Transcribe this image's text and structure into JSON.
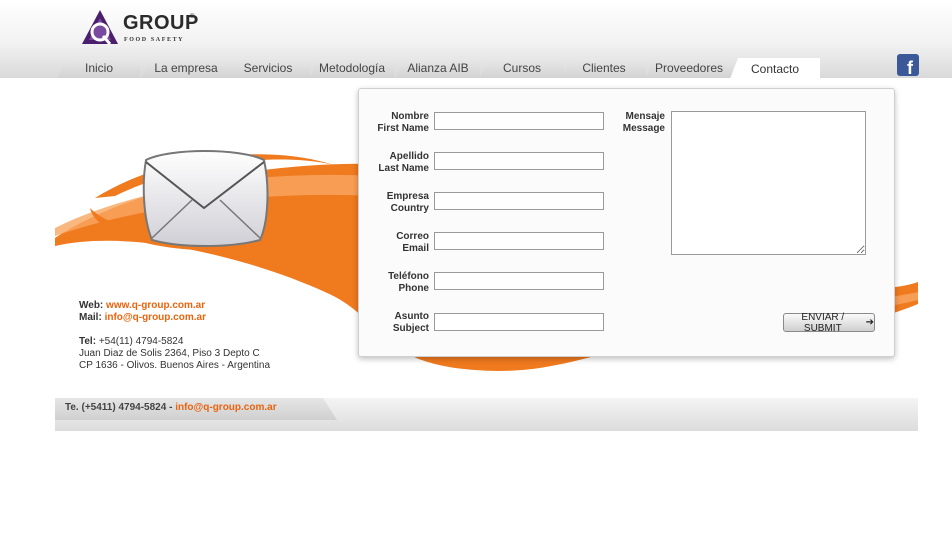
{
  "logo": {
    "word": "GROUP",
    "registered": "®",
    "tagline": "FOOD SAFETY"
  },
  "nav": {
    "tabs": [
      {
        "label": "Inicio"
      },
      {
        "label": "La empresa"
      },
      {
        "label": "Servicios"
      },
      {
        "label": "Metodología"
      },
      {
        "label": "Alianza AIB"
      },
      {
        "label": "Cursos"
      },
      {
        "label": "Clientes"
      },
      {
        "label": "Proveedores"
      },
      {
        "label": "Contacto"
      }
    ],
    "active": "Contacto"
  },
  "social": {
    "facebook_glyph": "f"
  },
  "form": {
    "fields": [
      {
        "label_es": "Nombre",
        "label_en": "First Name",
        "value": ""
      },
      {
        "label_es": "Apellido",
        "label_en": "Last Name",
        "value": ""
      },
      {
        "label_es": "Empresa",
        "label_en": "Country",
        "value": ""
      },
      {
        "label_es": "Correo",
        "label_en": "Email",
        "value": ""
      },
      {
        "label_es": "Teléfono",
        "label_en": "Phone",
        "value": ""
      },
      {
        "label_es": "Asunto",
        "label_en": "Subject",
        "value": ""
      }
    ],
    "message": {
      "label_es": "Mensaje",
      "label_en": "Message",
      "value": ""
    },
    "submit_label": "ENVIAR / SUBMIT",
    "submit_arrow": "➔"
  },
  "contact": {
    "web_label": "Web:",
    "web": "www.q-group.com.ar",
    "mail_label": "Mail:",
    "mail": "info@q-group.com.ar",
    "tel_label": "Tel:",
    "tel": "+54(11) 4794-5824",
    "address1": "Juan Diaz de Solis 2364, Piso 3 Depto C",
    "address2": "CP 1636 - Olivos. Buenos Aires - Argentina"
  },
  "footer": {
    "phone": "Te. (+5411) 4794-5824",
    "separator": "-",
    "email": "info@q-group.com.ar"
  },
  "colors": {
    "accent": "#e8640e",
    "logo_purple": "#4b1f6e",
    "facebook": "#3b5998"
  }
}
